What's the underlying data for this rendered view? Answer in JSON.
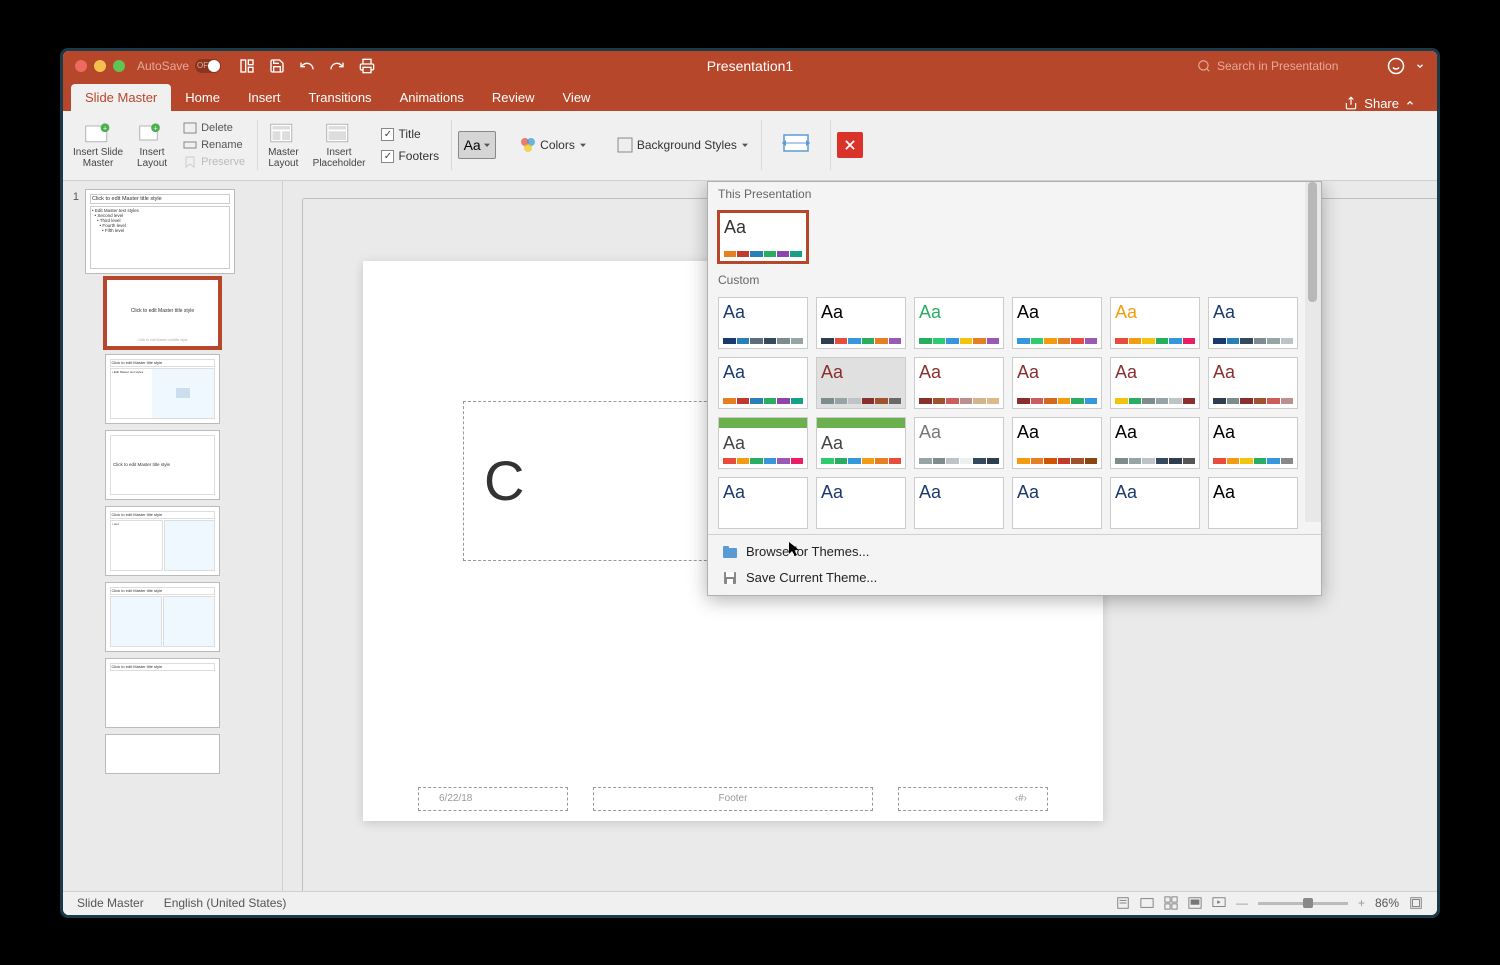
{
  "titlebar": {
    "autosave": "AutoSave",
    "autosave_state": "OFF",
    "doc_title": "Presentation1",
    "search_placeholder": "Search in Presentation"
  },
  "tabs": [
    "Slide Master",
    "Home",
    "Insert",
    "Transitions",
    "Animations",
    "Review",
    "View"
  ],
  "share": "Share",
  "ribbon": {
    "insert_slide_master": "Insert Slide\nMaster",
    "insert_layout": "Insert\nLayout",
    "delete": "Delete",
    "rename": "Rename",
    "preserve": "Preserve",
    "master_layout": "Master\nLayout",
    "insert_placeholder": "Insert\nPlaceholder",
    "title_chk": "Title",
    "footers_chk": "Footers",
    "colors": "Colors",
    "bg_styles": "Background Styles",
    "close": "Close"
  },
  "theme_dropdown": {
    "section1": "This Presentation",
    "section2": "Custom",
    "browse": "Browse for Themes...",
    "save": "Save Current Theme...",
    "themes": [
      {
        "aa": "#333",
        "bar": [
          "#e67e22",
          "#c0392b",
          "#2980b9",
          "#27ae60",
          "#8e44ad",
          "#16a085"
        ]
      },
      {
        "aa": "#1a3a6e",
        "bar": [
          "#1a3a6e",
          "#2980b9",
          "#5d6d7e",
          "#34495e",
          "#7f8c8d",
          "#95a5a6"
        ]
      },
      {
        "aa": "#000",
        "bar": [
          "#2c3e50",
          "#e74c3c",
          "#3498db",
          "#27ae60",
          "#e67e22",
          "#9b59b6"
        ]
      },
      {
        "aa": "#27ae60",
        "bar": [
          "#27ae60",
          "#2ecc71",
          "#3498db",
          "#f1c40f",
          "#e67e22",
          "#9b59b6"
        ]
      },
      {
        "aa": "#000",
        "bar": [
          "#3498db",
          "#2ecc71",
          "#f39c12",
          "#e67e22",
          "#e74c3c",
          "#9b59b6"
        ]
      },
      {
        "aa": "#f39c12",
        "bar": [
          "#e74c3c",
          "#f39c12",
          "#f1c40f",
          "#27ae60",
          "#3498db",
          "#e91e63"
        ]
      },
      {
        "aa": "#1a3a6e",
        "bar": [
          "#1a3a6e",
          "#2980b9",
          "#34495e",
          "#7f8c8d",
          "#95a5a6",
          "#bdc3c7"
        ]
      },
      {
        "aa": "#1a3a6e",
        "bar": [
          "#e67e22",
          "#c0392b",
          "#2980b9",
          "#27ae60",
          "#8e44ad",
          "#16a085"
        ]
      },
      {
        "aa": "#8b2e2e",
        "bar": [
          "#7f8c8d",
          "#95a5a6",
          "#bdc3c7",
          "#8b2e2e",
          "#a0522d",
          "#696969"
        ]
      },
      {
        "aa": "#8b2e2e",
        "bar": [
          "#8b2e2e",
          "#a0522d",
          "#cd5c5c",
          "#bc8f8f",
          "#d2b48c",
          "#deb887"
        ]
      },
      {
        "aa": "#8b2e2e",
        "bar": [
          "#8b2e2e",
          "#cd5c5c",
          "#d2691e",
          "#f39c12",
          "#27ae60",
          "#3498db"
        ]
      },
      {
        "aa": "#8b2e2e",
        "bar": [
          "#f1c40f",
          "#27ae60",
          "#7f8c8d",
          "#95a5a6",
          "#bdc3c7",
          "#8b2e2e"
        ]
      },
      {
        "aa": "#8b2e2e",
        "bar": [
          "#2c3e50",
          "#7f8c8d",
          "#8b2e2e",
          "#a0522d",
          "#cd5c5c",
          "#bc8f8f"
        ]
      },
      {
        "aa": "#444",
        "bar": [
          "#e74c3c",
          "#f39c12",
          "#27ae60",
          "#3498db",
          "#9b59b6",
          "#e91e63"
        ],
        "top": "#6ab04c"
      },
      {
        "aa": "#444",
        "bar": [
          "#2ecc71",
          "#27ae60",
          "#3498db",
          "#f39c12",
          "#e67e22",
          "#e74c3c"
        ],
        "top": "#6ab04c"
      },
      {
        "aa": "#777",
        "bar": [
          "#95a5a6",
          "#7f8c8d",
          "#bdc3c7",
          "#ecf0f1",
          "#34495e",
          "#2c3e50"
        ]
      },
      {
        "aa": "#000",
        "bar": [
          "#f39c12",
          "#e67e22",
          "#d35400",
          "#c0392b",
          "#a0522d",
          "#8b4513"
        ]
      },
      {
        "aa": "#000",
        "bar": [
          "#7f8c8d",
          "#95a5a6",
          "#bdc3c7",
          "#34495e",
          "#2c3e50",
          "#555"
        ]
      },
      {
        "aa": "#000",
        "bar": [
          "#e74c3c",
          "#f39c12",
          "#f1c40f",
          "#27ae60",
          "#3498db",
          "#888"
        ]
      },
      {
        "aa": "#1a3a6e",
        "bar": []
      },
      {
        "aa": "#1a3a6e",
        "bar": []
      },
      {
        "aa": "#1a3a6e",
        "bar": []
      },
      {
        "aa": "#1a3a6e",
        "bar": []
      },
      {
        "aa": "#1a3a6e",
        "bar": []
      },
      {
        "aa": "#000",
        "bar": []
      }
    ]
  },
  "slide": {
    "title_placeholder": "C",
    "date": "6/22/18",
    "footer": "Footer",
    "num": "‹#›"
  },
  "thumbnails": {
    "master_title": "Click to edit Master title style",
    "master_bullets": "Edit Master text styles",
    "layout_title": "Click to edit Master title style"
  },
  "statusbar": {
    "view": "Slide Master",
    "lang": "English (United States)",
    "zoom": "86%"
  }
}
